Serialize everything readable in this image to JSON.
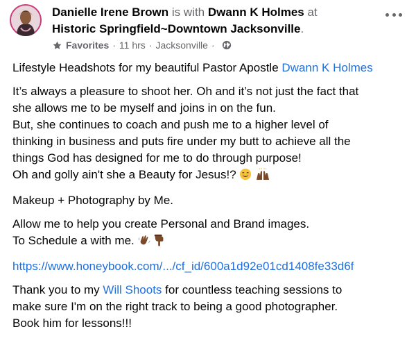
{
  "header": {
    "author": "Danielle Irene Brown",
    "with_text": "is with",
    "tagged_person": "Dwann K Holmes",
    "at_text": "at",
    "location": "Historic Springfield~Downtown Jacksonville",
    "location_suffix": "."
  },
  "meta": {
    "favorites": "Favorites",
    "sep1": "·",
    "time": "11 hrs",
    "sep2": "·",
    "place": "Jacksonville",
    "sep3": "·",
    "privacy_icon": "globe-icon",
    "favorites_icon": "star-icon"
  },
  "more_icon": "more-options-icon",
  "body": {
    "p1_text": "Lifestyle Headshots for my beautiful Pastor Apostle",
    "p1_link": "Dwann K Holmes",
    "p2_l1": "It’s always a pleasure to shoot her. Oh and it’s not just the fact that",
    "p2_l2": "she allows me to be myself and joins in on the fun.",
    "p2_l3": "But, she continues to coach and push me to a higher level of",
    "p2_l4": "thinking in business and puts fire under my butt to achieve all the",
    "p2_l5": "things God has designed for me to do through purpose!",
    "p2_l6": "Oh and golly ain't she a Beauty for Jesus!?",
    "p3": "Makeup + Photography by Me.",
    "p4_l1": "Allow me to help you create Personal and Brand images.",
    "p4_l2": "To Schedule a with me.",
    "url": "https://www.honeybook.com/.../cf_id/600a1d92e01cd1408fe33d6f",
    "p6_prefix": "Thank you to my",
    "p6_link": "Will Shoots",
    "p6_suffix": "for countless teaching sessions to",
    "p6_l2": "make sure I'm on the right track to being a good photographer.",
    "p6_l3": "Book him for lessons!!!"
  },
  "colors": {
    "link": "#216fdb",
    "muted": "#65676b",
    "text": "#050505"
  }
}
